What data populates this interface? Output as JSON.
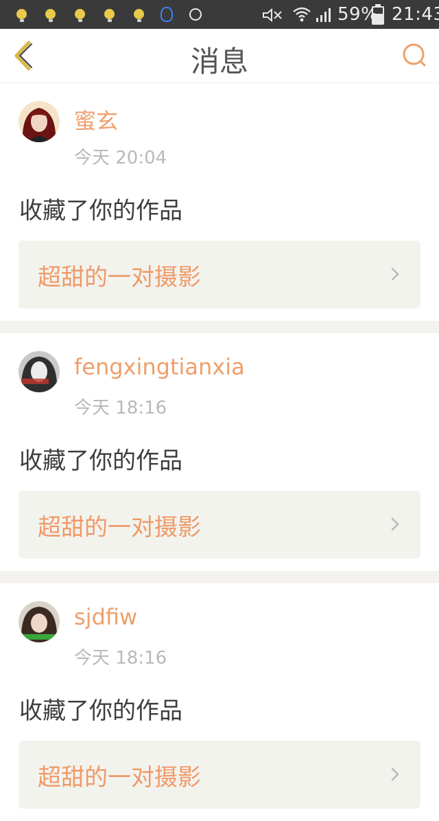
{
  "status_bar": {
    "notification_icons": [
      "bulb-icon",
      "bulb-icon",
      "bulb-icon",
      "bulb-icon",
      "bulb-icon",
      "qq-icon",
      "disc-icon"
    ],
    "battery_percent": "59%",
    "battery_level": 0.59,
    "time": "21:43"
  },
  "header": {
    "title": "消息",
    "back_icon": "chevron-left-icon",
    "search_icon": "search-icon"
  },
  "colors": {
    "accent": "#ee9f6b",
    "card_bg": "#f3f3ee",
    "separator": "#f3f2ee"
  },
  "messages": [
    {
      "username": "蜜玄",
      "time": "今天 20:04",
      "action": "收藏了你的作品",
      "work_title": "超甜的一对摄影"
    },
    {
      "username": "fengxingtianxia",
      "time": "今天 18:16",
      "action": "收藏了你的作品",
      "work_title": "超甜的一对摄影"
    },
    {
      "username": "sjdfiw",
      "time": "今天 18:16",
      "action": "收藏了你的作品",
      "work_title": "超甜的一对摄影"
    }
  ]
}
